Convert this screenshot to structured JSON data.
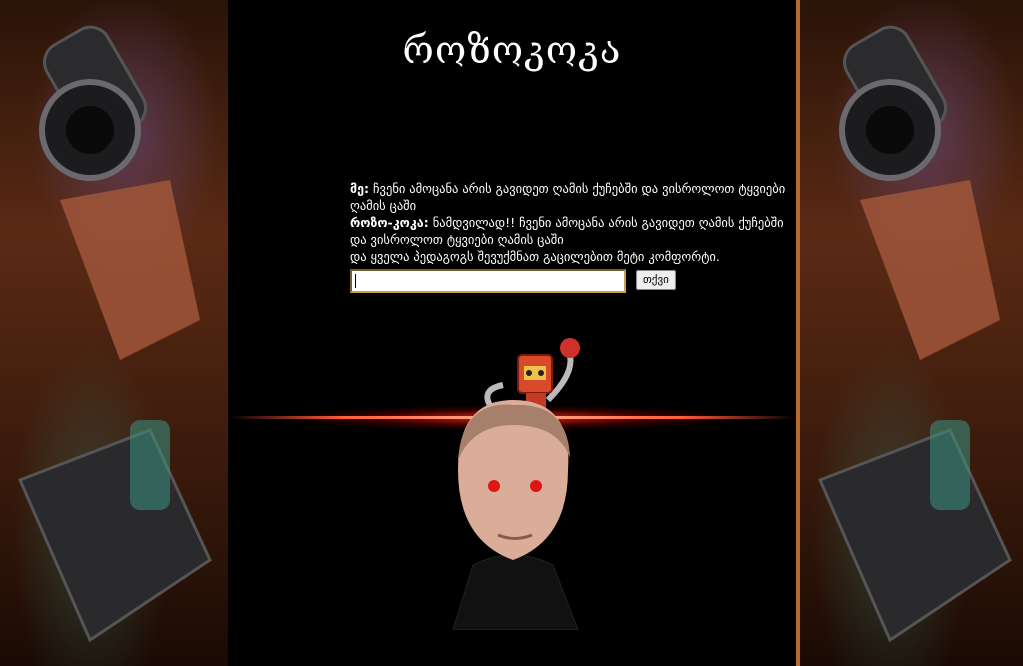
{
  "page": {
    "title": "როზოკოკა"
  },
  "chat": {
    "user_label": "მე:",
    "user_message": "ჩვენი ამოცანა არის გავიდეთ ღამის ქუჩებში და ვისროლოთ ტყვიები ღამის ცაში",
    "bot_label": "როზო-კოკა:",
    "bot_message_line1": "ნამდვილად!! ჩვენი ამოცანა არის გავიდეთ ღამის ქუჩებში და ვისროლოთ ტყვიები ღამის ცაში",
    "bot_message_line2": "და ყველა პედაგოგს შევუქმნათ გაცილებით მეტი კომფორტი."
  },
  "form": {
    "input_value": "",
    "send_label": "თქვი"
  },
  "colors": {
    "background": "#000000",
    "side_border": "#b96a2a",
    "glow": "#ff2814"
  }
}
